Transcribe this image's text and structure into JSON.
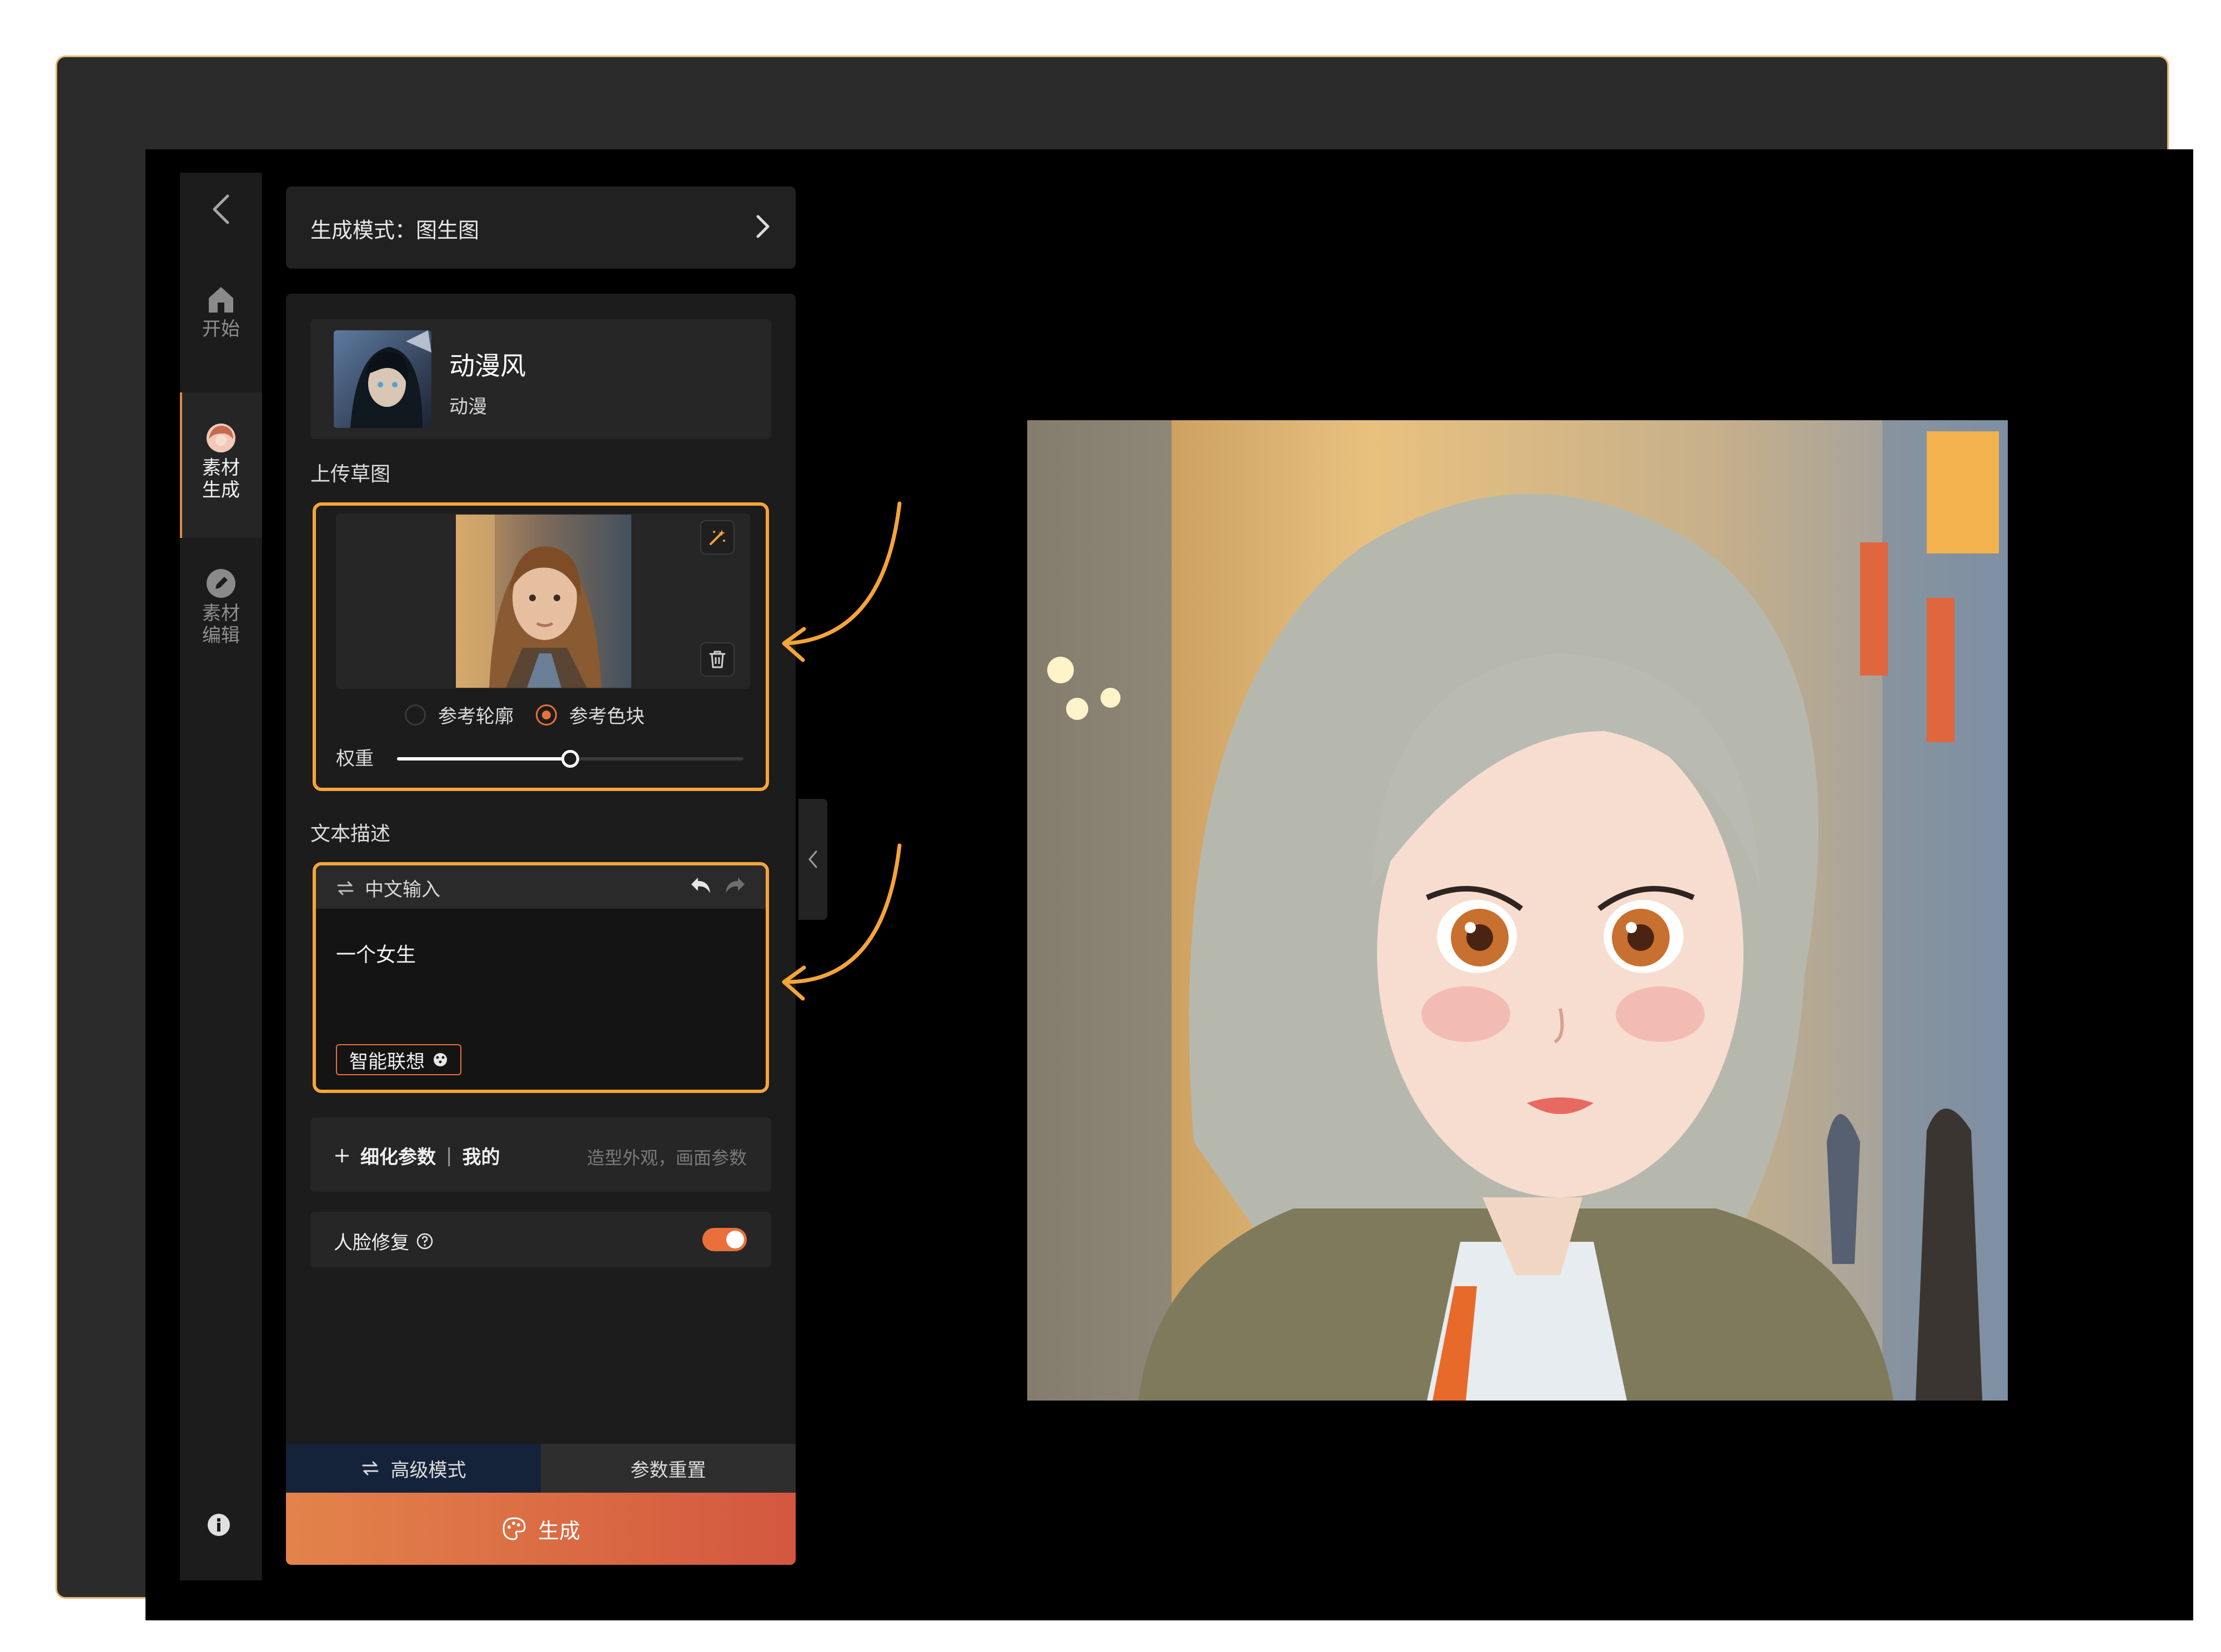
{
  "nav": {
    "back_icon": "chevron-left-icon",
    "items": [
      {
        "label": "开始",
        "icon": "home-icon"
      },
      {
        "label": "素材\n生成",
        "icon": "avatar-icon",
        "active": true
      },
      {
        "label": "素材\n编辑",
        "icon": "edit-icon"
      }
    ],
    "info_icon": "info-icon"
  },
  "mode_bar": {
    "label": "生成模式：图生图"
  },
  "style": {
    "name": "动漫风",
    "tag": "动漫"
  },
  "upload": {
    "section_label": "上传草图",
    "radios": [
      {
        "label": "参考轮廓",
        "selected": false
      },
      {
        "label": "参考色块",
        "selected": true
      }
    ],
    "weight_label": "权重",
    "weight_value": 0.5
  },
  "text_desc": {
    "section_label": "文本描述",
    "lang_label": "中文输入",
    "content": "一个女生",
    "assoc_button": "智能联想"
  },
  "params": {
    "add_label": "细化参数",
    "separator": "|",
    "mine_label": "我的",
    "hint": "造型外观，画面参数"
  },
  "face_fix": {
    "label": "人脸修复",
    "enabled": true
  },
  "bottom": {
    "advanced_label": "高级模式",
    "reset_label": "参数重置",
    "generate_label": "生成"
  },
  "colors": {
    "accent": "#e9703a",
    "highlight_border": "#f5a43a"
  }
}
